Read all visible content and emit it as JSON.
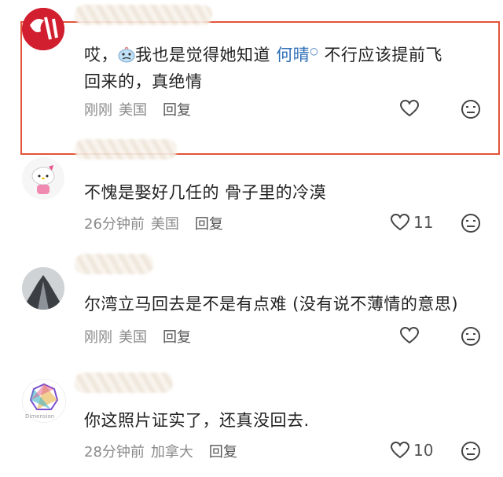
{
  "comments": [
    {
      "text_parts": [
        "哎，",
        "我也是觉得她知道 ",
        "何晴",
        " 不行应该提前飞"
      ],
      "text_line2": "回来的，真绝情",
      "time": "刚刚",
      "location": "美国",
      "reply": "回复",
      "likes": ""
    },
    {
      "text": "不愧是娶好几任的 骨子里的冷漠",
      "time": "26分钟前",
      "location": "美国",
      "reply": "回复",
      "likes": "11"
    },
    {
      "text": "尔湾立马回去是不是有点难 (没有说不薄情的意思)",
      "time": "刚刚",
      "location": "美国",
      "reply": "回复",
      "likes": ""
    },
    {
      "text": "你这照片证实了，还真没回去.",
      "time": "28分钟前",
      "location": "加拿大",
      "reply": "回复",
      "likes": "10"
    }
  ],
  "avatar4_label": "Dimension",
  "icons": {
    "like": "heart-outline-icon",
    "dislike": "neutral-face-icon",
    "emoji": "crying-face-emoji",
    "search": "search-icon"
  },
  "colors": {
    "highlight_border": "#e2543a",
    "mention": "#2f6fb8",
    "meta": "#8a8a8a"
  }
}
